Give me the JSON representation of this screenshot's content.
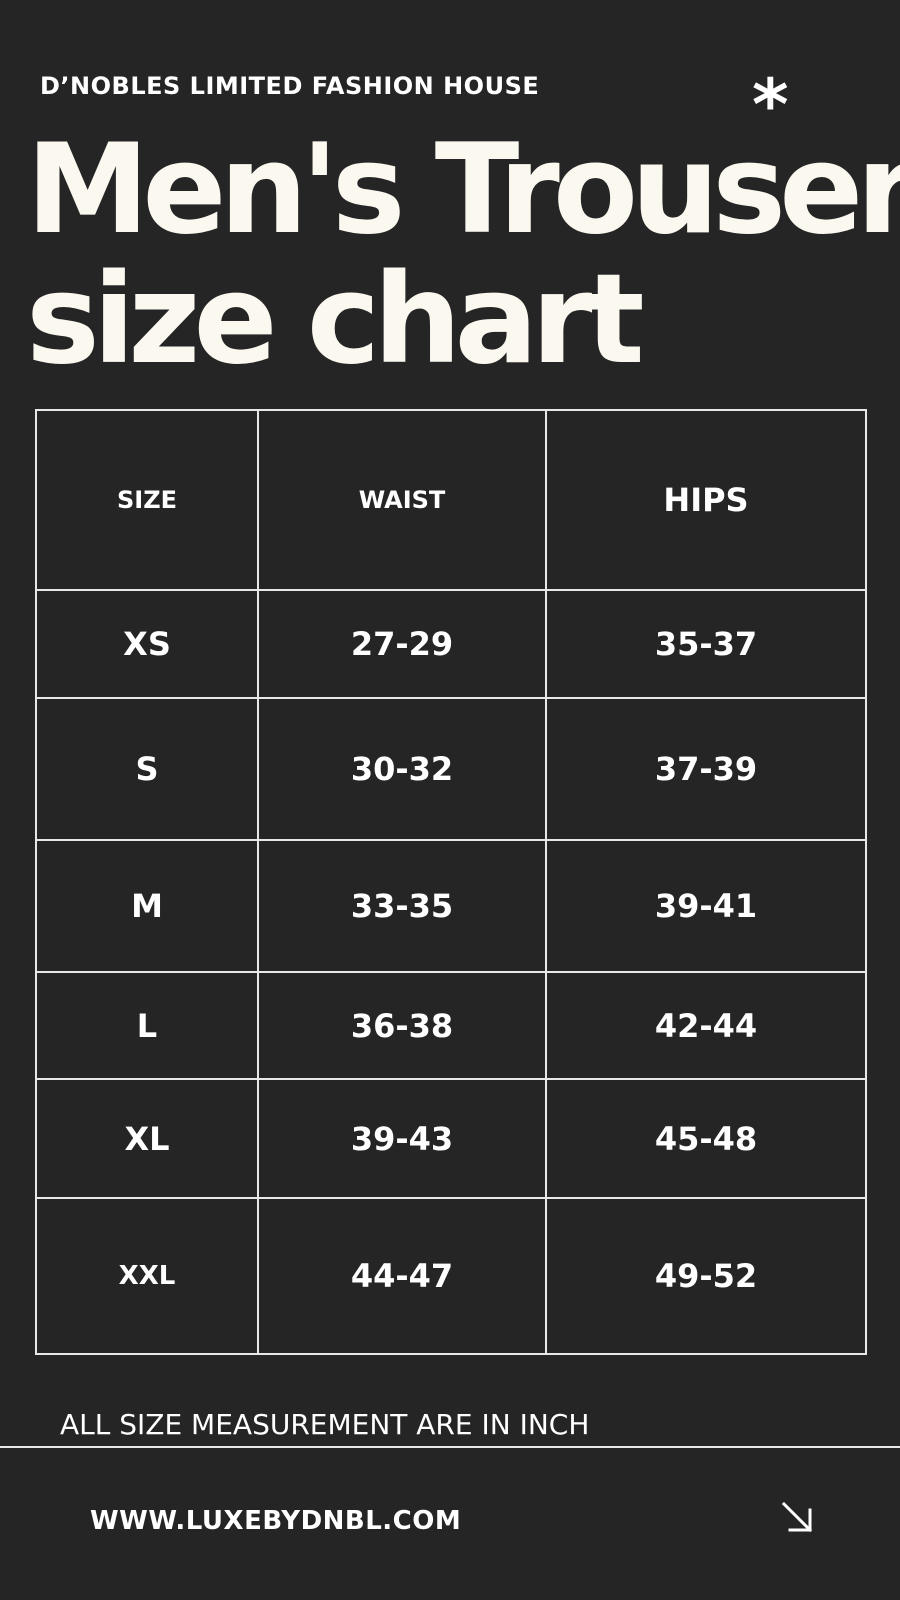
{
  "brand": "D’NOBLES LIMITED FASHION HOUSE",
  "title_line1": "Men's Trouser",
  "title_line2": "size chart",
  "decoration": {
    "asterisk": "*"
  },
  "table": {
    "headers": [
      "SIZE",
      "WAIST",
      "HIPS"
    ],
    "rows": [
      [
        "XS",
        "27-29",
        "35-37"
      ],
      [
        "S",
        "30-32",
        "37-39"
      ],
      [
        "M",
        "33-35",
        "39-41"
      ],
      [
        "L",
        "36-38",
        "42-44"
      ],
      [
        "XL",
        "39-43",
        "45-48"
      ],
      [
        "XXL",
        "44-47",
        "49-52"
      ]
    ]
  },
  "note": "ALL SIZE MEASUREMENT ARE IN INCH",
  "website": "WWW.LUXEBYDNBL.COM",
  "icons": {
    "arrow": "arrow-down-right-icon"
  },
  "colors": {
    "background": "#252525",
    "text": "#ffffff",
    "border": "#e8e8e8"
  }
}
